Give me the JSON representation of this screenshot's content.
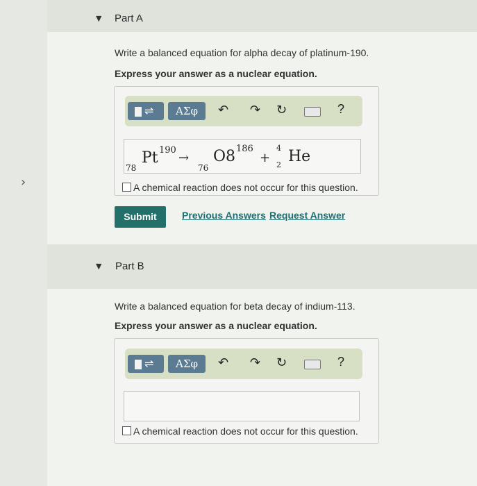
{
  "part_a": {
    "title": "Part A",
    "prompt": "Write a balanced equation for alpha decay of platinum-190.",
    "instruction": "Express your answer as a nuclear equation.",
    "toolbar": {
      "greek_label": "ΑΣφ",
      "help_label": "?"
    },
    "equation": {
      "pt_z": "78",
      "pt_symbol": "Pt",
      "pt_a": "190",
      "arrow": "→",
      "os_z": "76",
      "os_symbol": "O8",
      "os_a": "186",
      "plus": "+",
      "he_a": "4",
      "he_z": "2",
      "he_symbol": "He"
    },
    "no_reaction_label": "A chemical reaction does not occur for this question.",
    "submit_label": "Submit",
    "previous_answers_label": "Previous Answers",
    "request_answer_label": "Request Answer"
  },
  "part_b": {
    "title": "Part B",
    "prompt": "Write a balanced equation for beta decay of indium-113.",
    "instruction": "Express your answer as a nuclear equation.",
    "toolbar": {
      "greek_label": "ΑΣφ",
      "help_label": "?"
    },
    "no_reaction_label": "A chemical reaction does not occur for this question."
  },
  "icons": [
    "templates-icon",
    "greek-letters-icon",
    "undo-icon",
    "redo-icon",
    "reset-icon",
    "keyboard-icon",
    "help-icon",
    "expand-arrow-icon"
  ]
}
